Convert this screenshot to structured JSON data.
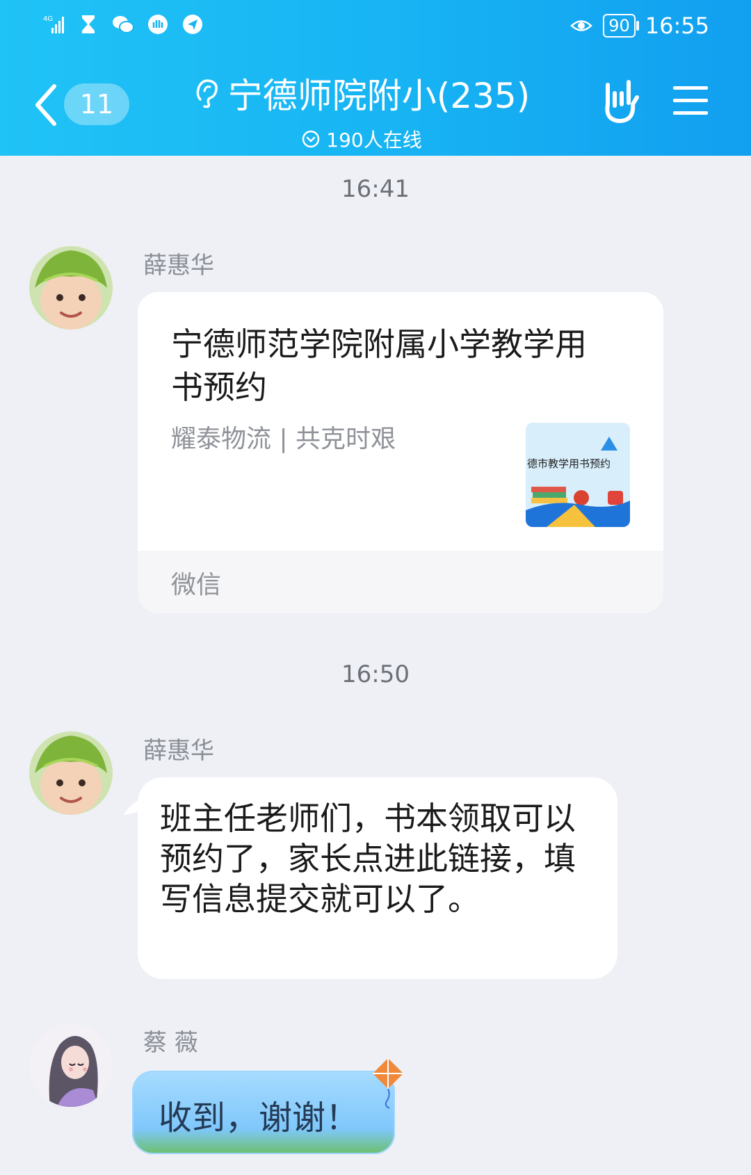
{
  "status_bar": {
    "time": "16:55",
    "battery": "90",
    "network": "4G"
  },
  "header": {
    "back_count": "11",
    "title": "宁德师院附小(235)",
    "online": "190人在线"
  },
  "messages": [
    {
      "timestamp": "16:41",
      "sender": "薛惠华",
      "type": "link_card",
      "card_title": "宁德师范学院附属小学教学用书预约",
      "card_desc": "耀泰物流 | 共克时艰",
      "card_source": "微信",
      "thumb_text": "德市教学用书预约"
    },
    {
      "timestamp": "16:50",
      "sender": "薛惠华",
      "type": "text",
      "text": "班主任老师们，书本领取可以预约了，家长点进此链接，填写信息提交就可以了。"
    },
    {
      "sender": "蔡  薇",
      "type": "text",
      "text": "收到，谢谢！"
    }
  ],
  "colors": {
    "header_gradient_start": "#20c3f6",
    "header_gradient_end": "#129ff0",
    "background": "#eef0f5"
  }
}
